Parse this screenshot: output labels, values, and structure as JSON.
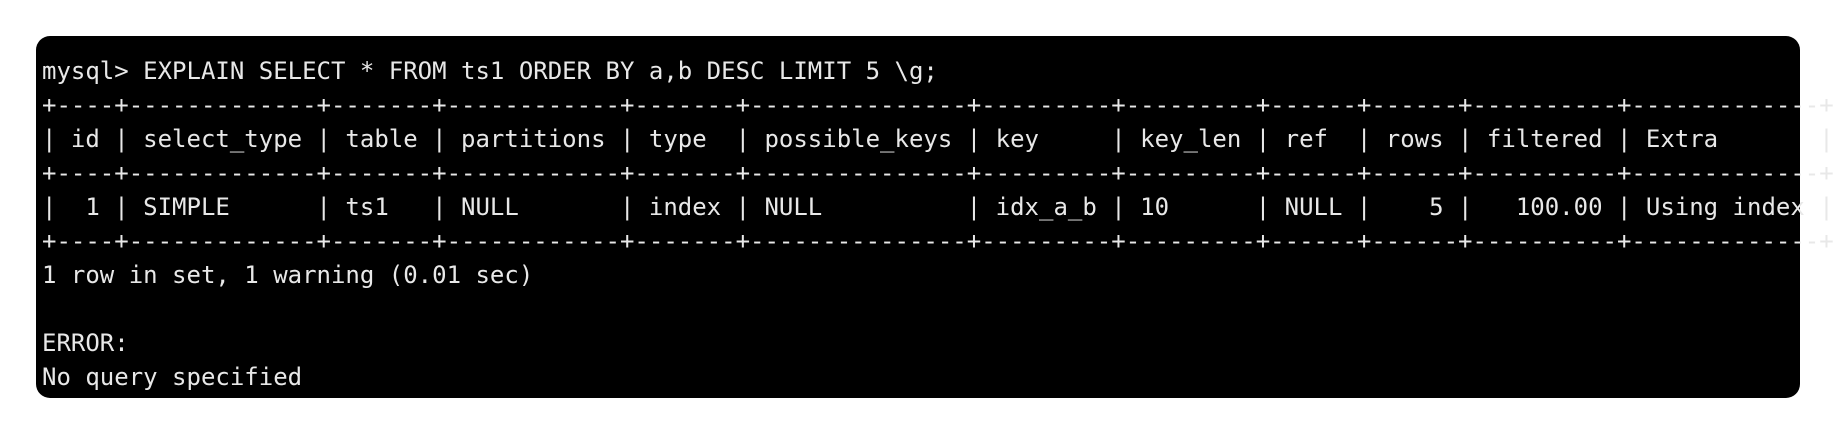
{
  "terminal": {
    "lines": [
      "mysql> EXPLAIN SELECT * FROM ts1 ORDER BY a,b DESC LIMIT 5 \\g;",
      "+----+-------------+-------+------------+-------+---------------+---------+---------+------+------+----------+-------------+",
      "| id | select_type | table | partitions | type  | possible_keys | key     | key_len | ref  | rows | filtered | Extra       |",
      "+----+-------------+-------+------------+-------+---------------+---------+---------+------+------+----------+-------------+",
      "|  1 | SIMPLE      | ts1   | NULL       | index | NULL          | idx_a_b | 10      | NULL |    5 |   100.00 | Using index |",
      "+----+-------------+-------+------------+-------+---------------+---------+---------+------+------+----------+-------------+",
      "1 row in set, 1 warning (0.01 sec)",
      "",
      "ERROR:",
      "No query specified"
    ]
  }
}
